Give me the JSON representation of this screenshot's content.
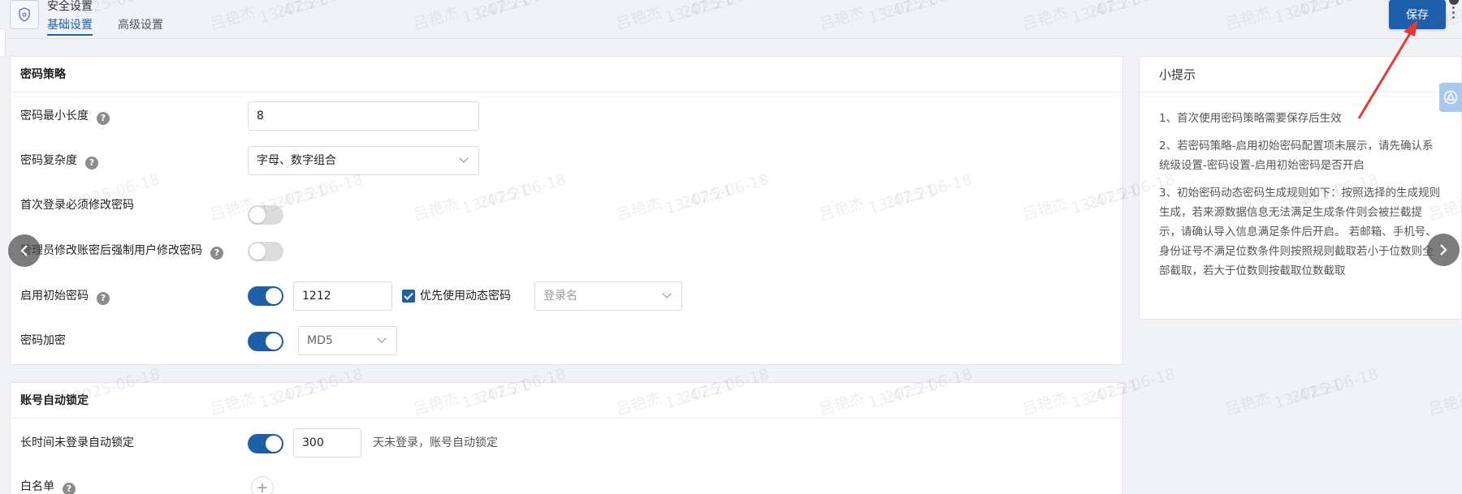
{
  "header": {
    "title": "安全设置",
    "tabs": [
      {
        "label": "基础设置",
        "active": true
      },
      {
        "label": "高级设置",
        "active": false
      }
    ],
    "save_label": "保存"
  },
  "policy": {
    "title": "密码策略",
    "min_length": {
      "label": "密码最小长度",
      "value": "8"
    },
    "complexity": {
      "label": "密码复杂度",
      "value": "字母、数字组合"
    },
    "first_login": {
      "label": "首次登录必须修改密码",
      "enabled": false
    },
    "admin_modify": {
      "label": "管理员修改账密后强制用户修改密码",
      "enabled": false
    },
    "initial_password": {
      "label": "启用初始密码",
      "enabled": true,
      "value": "1212",
      "dynamic_checkbox_label": "优先使用动态密码",
      "dynamic_checked": true,
      "source_placeholder": "登录名"
    },
    "encryption": {
      "label": "密码加密",
      "enabled": true,
      "algorithm": "MD5"
    }
  },
  "lock": {
    "title": "账号自动锁定",
    "inactive_lock": {
      "label": "长时间未登录自动锁定",
      "enabled": true,
      "days": "300",
      "suffix": "天未登录，账号自动锁定"
    },
    "whitelist": {
      "label": "白名单"
    }
  },
  "tips": {
    "title": "小提示",
    "items": [
      "1、首次使用密码策略需要保存后生效",
      "2、若密码策略-启用初始密码配置项未展示，请先确认系统级设置-密码设置-启用初始密码是否开启",
      "3、初始密码动态密码生成规则如下：按照选择的生成规则生成，若来源数据信息无法满足生成条件则会被拦截提示，请确认导入信息满足条件后开启。 若邮箱、手机号、身份证号不满足位数条件则按照规则截取若小于位数则全部截取，若大于位数则按截取位数截取"
    ]
  },
  "watermark": {
    "name": "吕艳杰",
    "date": "2025-06-18",
    "time": "13:47:21"
  },
  "colors": {
    "primary": "#1d5fa8",
    "annotation_arrow": "#e53935"
  }
}
